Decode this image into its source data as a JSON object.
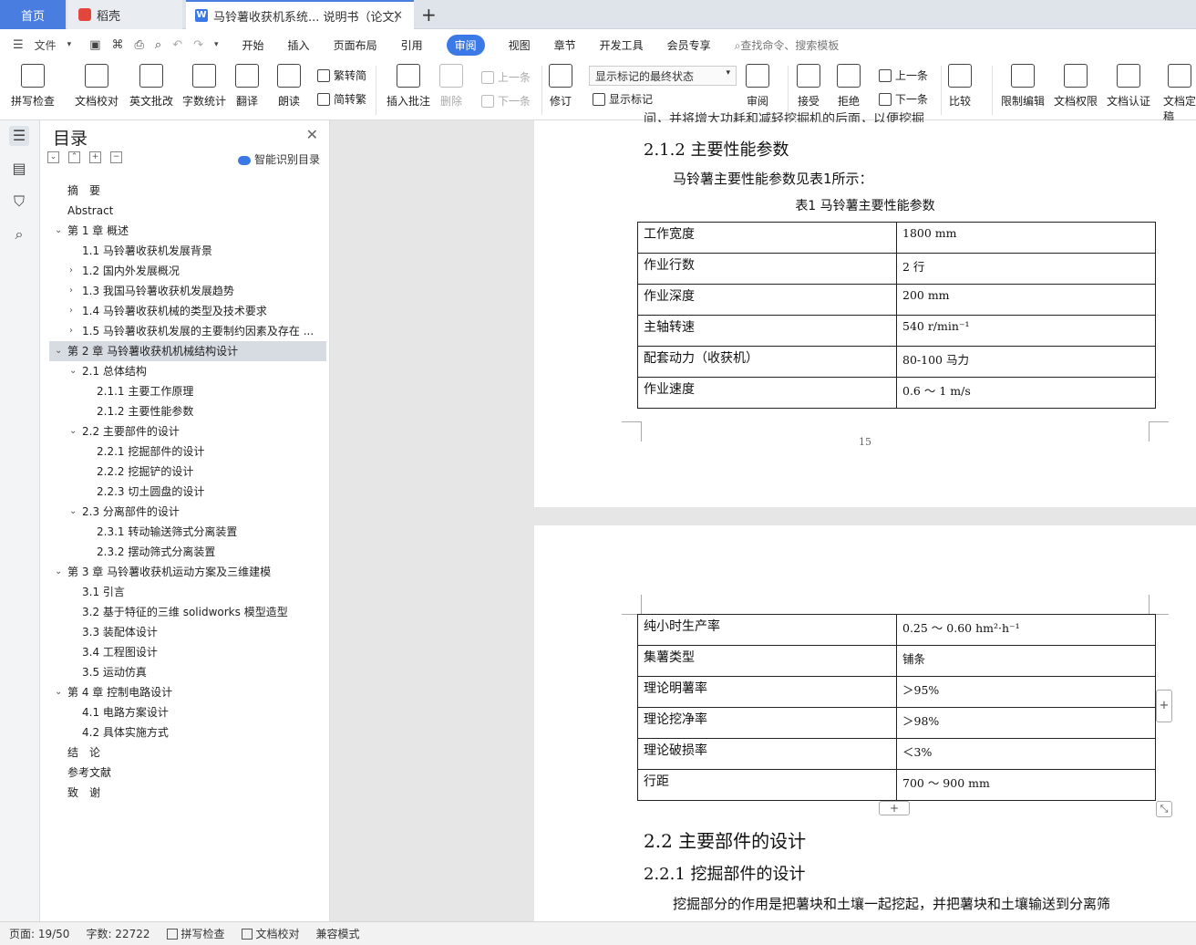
{
  "tabs": {
    "home": "首页",
    "daoke": "稻壳",
    "document": "马铃薯收获机系统... 说明书（论文）"
  },
  "menu": {
    "file": "文件",
    "items": [
      "开始",
      "插入",
      "页面布局",
      "引用",
      "审阅",
      "视图",
      "章节",
      "开发工具",
      "会员专享"
    ],
    "active": "审阅",
    "search": "查找命令、搜索模板"
  },
  "ribbon": {
    "spell": "拼写检查",
    "doc_proof": "文档校对",
    "en_review": "英文批改",
    "word_count": "字数统计",
    "translate": "翻译",
    "read_aloud": "朗读",
    "trad": "繁转简",
    "simp": "简转繁",
    "insert_comment": "插入批注",
    "delete": "删除",
    "prev": "上一条",
    "next": "下一条",
    "revise": "修订",
    "markup_state": "显示标记的最终状态",
    "show_markup": "显示标记",
    "review": "审阅",
    "accept": "接受",
    "reject": "拒绝",
    "prev2": "上一条",
    "next2": "下一条",
    "compare": "比较",
    "restrict": "限制编辑",
    "doc_perm": "文档权限",
    "doc_cert": "文档认证",
    "doc_final": "文档定稿"
  },
  "toc": {
    "title": "目录",
    "smart": "智能识别目录",
    "items": [
      {
        "label": "摘　要",
        "level": 0,
        "chev": ""
      },
      {
        "label": "Abstract",
        "level": 0,
        "chev": ""
      },
      {
        "label": "第 1 章  概述",
        "level": 0,
        "chev": "v"
      },
      {
        "label": "1.1 马铃薯收获机发展背景",
        "level": 1,
        "chev": ""
      },
      {
        "label": "1.2 国内外发展概况",
        "level": 1,
        "chev": ">"
      },
      {
        "label": "1.3 我国马铃薯收获机发展趋势",
        "level": 1,
        "chev": ">"
      },
      {
        "label": "1.4 马铃薯收获机械的类型及技术要求",
        "level": 1,
        "chev": ">"
      },
      {
        "label": "1.5 马铃薯收获机发展的主要制约因素及存在 ...",
        "level": 1,
        "chev": ">"
      },
      {
        "label": "第 2 章  马铃薯收获机机械结构设计",
        "level": 0,
        "chev": "v",
        "selected": true
      },
      {
        "label": "2.1 总体结构",
        "level": 1,
        "chev": "v"
      },
      {
        "label": "2.1.1 主要工作原理",
        "level": 2,
        "chev": ""
      },
      {
        "label": "2.1.2 主要性能参数",
        "level": 2,
        "chev": ""
      },
      {
        "label": "2.2 主要部件的设计",
        "level": 1,
        "chev": "v"
      },
      {
        "label": "2.2.1 挖掘部件的设计",
        "level": 2,
        "chev": ""
      },
      {
        "label": "2.2.2 挖掘铲的设计",
        "level": 2,
        "chev": ""
      },
      {
        "label": "2.2.3 切土圆盘的设计",
        "level": 2,
        "chev": ""
      },
      {
        "label": "2.3 分离部件的设计",
        "level": 1,
        "chev": "v"
      },
      {
        "label": "2.3.1 转动输送筛式分离装置",
        "level": 2,
        "chev": ""
      },
      {
        "label": "2.3.2 摆动筛式分离装置",
        "level": 2,
        "chev": ""
      },
      {
        "label": "第 3 章  马铃薯收获机运动方案及三维建模",
        "level": 0,
        "chev": "v"
      },
      {
        "label": "3.1 引言",
        "level": 1,
        "chev": ""
      },
      {
        "label": "3.2 基于特征的三维 solidworks 模型造型",
        "level": 1,
        "chev": ""
      },
      {
        "label": "3.3 装配体设计",
        "level": 1,
        "chev": ""
      },
      {
        "label": "3.4 工程图设计",
        "level": 1,
        "chev": ""
      },
      {
        "label": "3.5 运动仿真",
        "level": 1,
        "chev": ""
      },
      {
        "label": "第 4 章  控制电路设计",
        "level": 0,
        "chev": "v"
      },
      {
        "label": "4.1 电路方案设计",
        "level": 1,
        "chev": ""
      },
      {
        "label": "4.2 具体实施方式",
        "level": 1,
        "chev": ""
      },
      {
        "label": "结　论",
        "level": 0,
        "chev": ""
      },
      {
        "label": "参考文献",
        "level": 0,
        "chev": ""
      },
      {
        "label": "致　谢",
        "level": 0,
        "chev": ""
      }
    ]
  },
  "doc": {
    "top_fragment": "间，并将增大功耗和减轻挖掘机的后面，以便挖掘",
    "h_212": "2.1.2 主要性能参数",
    "para_212": "马铃薯主要性能参数见表1所示：",
    "table_caption": "表1  马铃薯主要性能参数",
    "table1": [
      [
        "工作宽度",
        "1800      mm"
      ],
      [
        "作业行数",
        "2      行"
      ],
      [
        "作业深度",
        "200     mm"
      ],
      [
        "主轴转速",
        "540     r/min⁻¹"
      ],
      [
        "配套动力（收获机）",
        "80-100    马力"
      ],
      [
        "作业速度",
        "0.6  ～  1     m/s"
      ]
    ],
    "page_number": "15",
    "table2": [
      [
        "纯小时生产率",
        "0.25  ～  0.60    hm²·h⁻¹"
      ],
      [
        "集薯类型",
        "铺条"
      ],
      [
        "理论明薯率",
        "＞95%"
      ],
      [
        "理论挖净率",
        "＞98%"
      ],
      [
        "理论破损率",
        "＜3%"
      ],
      [
        "  行距",
        "  700  ～  900     mm"
      ]
    ],
    "h_22": "2.2 主要部件的设计",
    "h_221": "2.2.1 挖掘部件的设计",
    "para_221": "挖掘部分的作用是把薯块和土壤一起挖起，并把薯块和土壤输送到分离筛"
  },
  "status": {
    "page": "页面: 19/50",
    "words": "字数: 22722",
    "spell": "拼写检查",
    "proof": "文档校对",
    "compat": "兼容模式"
  }
}
